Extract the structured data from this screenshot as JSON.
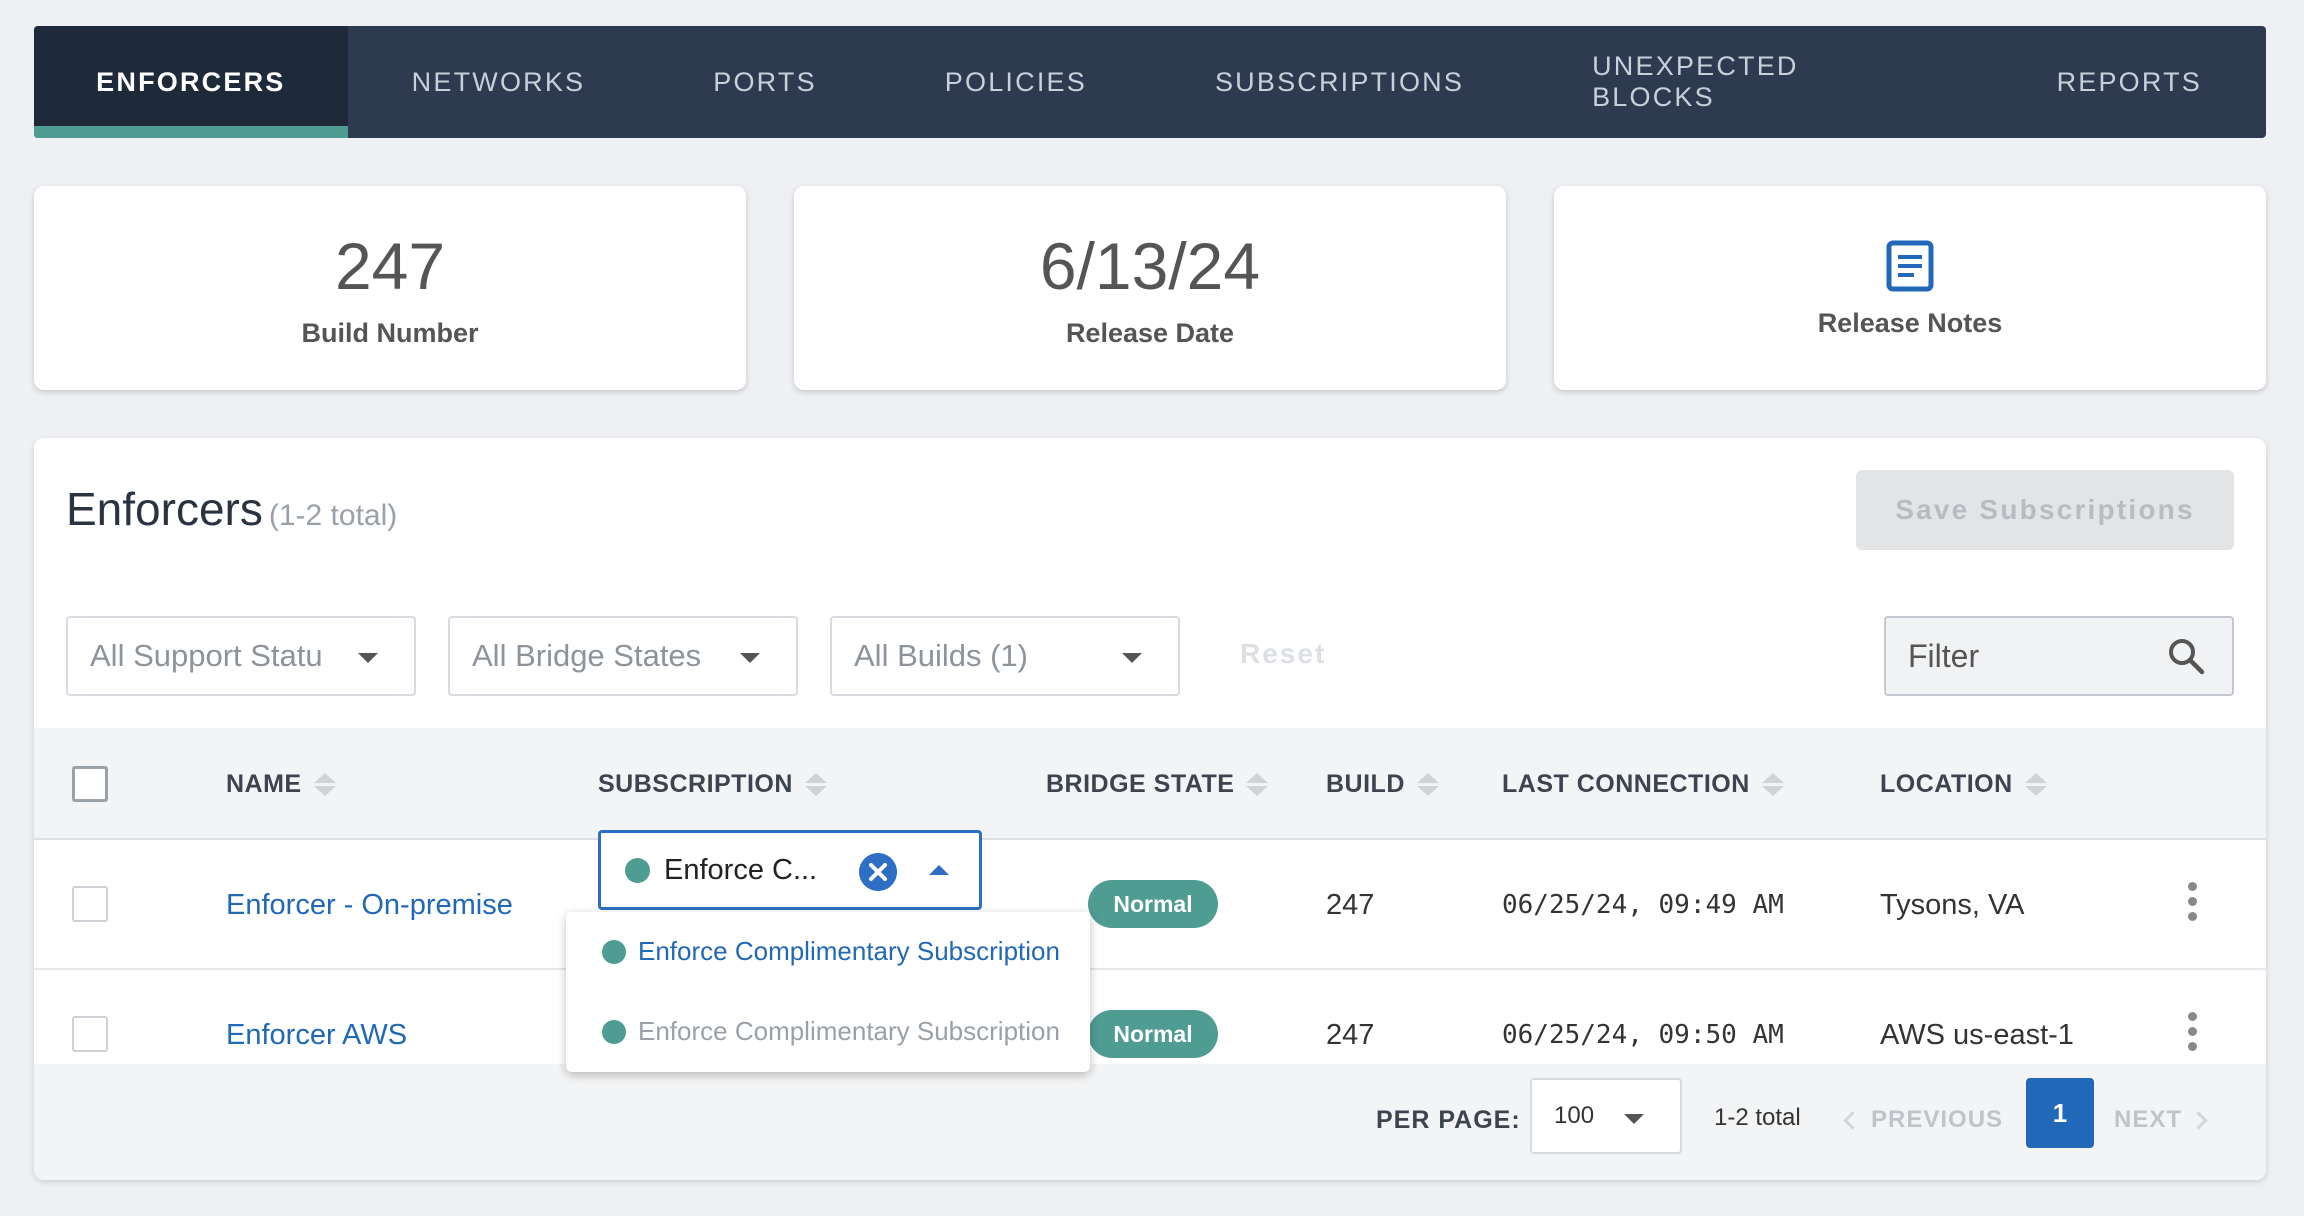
{
  "nav": {
    "tabs": [
      {
        "label": "ENFORCERS",
        "active": true
      },
      {
        "label": "NETWORKS"
      },
      {
        "label": "PORTS"
      },
      {
        "label": "POLICIES"
      },
      {
        "label": "SUBSCRIPTIONS"
      },
      {
        "label": "UNEXPECTED BLOCKS"
      },
      {
        "label": "REPORTS"
      }
    ]
  },
  "cards": {
    "build": {
      "value": "247",
      "label": "Build Number"
    },
    "release": {
      "value": "6/13/24",
      "label": "Release Date"
    },
    "notes": {
      "icon": "document-icon",
      "label": "Release Notes"
    }
  },
  "panel": {
    "title": "Enforcers",
    "subtitle": "(1-2 total)",
    "save_label": "Save Subscriptions"
  },
  "filters": {
    "support": "All Support Statu",
    "bridge": "All Bridge States",
    "builds": "All Builds (1)",
    "reset": "Reset",
    "filter_placeholder": "Filter"
  },
  "table": {
    "headers": {
      "name": "NAME",
      "subscription": "SUBSCRIPTION",
      "bridge_state": "BRIDGE STATE",
      "build": "BUILD",
      "last_connection": "LAST CONNECTION",
      "location": "LOCATION"
    },
    "rows": [
      {
        "name": "Enforcer - On-premise",
        "subscription": "Enforce C...",
        "bridge_state": "Normal",
        "build": "247",
        "last_connection": "06/25/24, 09:49 AM",
        "location": "Tysons, VA"
      },
      {
        "name": "Enforcer AWS",
        "subscription": "",
        "bridge_state": "Normal",
        "build": "247",
        "last_connection": "06/25/24, 09:50 AM",
        "location": "AWS us-east-1"
      }
    ]
  },
  "dropdown": {
    "options": [
      {
        "label": "Enforce Complimentary Subscription",
        "selected": true
      },
      {
        "label": "Enforce Complimentary Subscription",
        "selected": false
      }
    ]
  },
  "footer": {
    "per_page_label": "PER PAGE:",
    "per_page_value": "100",
    "total": "1-2 total",
    "previous": "PREVIOUS",
    "page": "1",
    "next": "NEXT"
  },
  "colors": {
    "nav_bg": "#2d3a4f",
    "accent_teal": "#4f9c92",
    "link_blue": "#2168b9"
  }
}
